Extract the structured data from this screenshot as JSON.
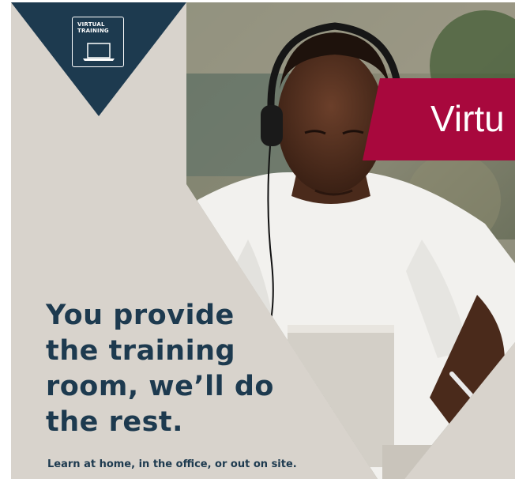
{
  "badge": {
    "text": "VIRTUAL\nTRAINING",
    "icon": "laptop-icon"
  },
  "banner": {
    "text": "Virtu"
  },
  "headline": {
    "text": "You provide\nthe training\nroom, we’ll do\nthe rest."
  },
  "subline": {
    "text": "Learn at home, in the office, or out on site."
  },
  "colors": {
    "navy": "#1d3a4f",
    "crimson": "#a8083d",
    "beige": "#d8d3cc",
    "white": "#ffffff"
  }
}
